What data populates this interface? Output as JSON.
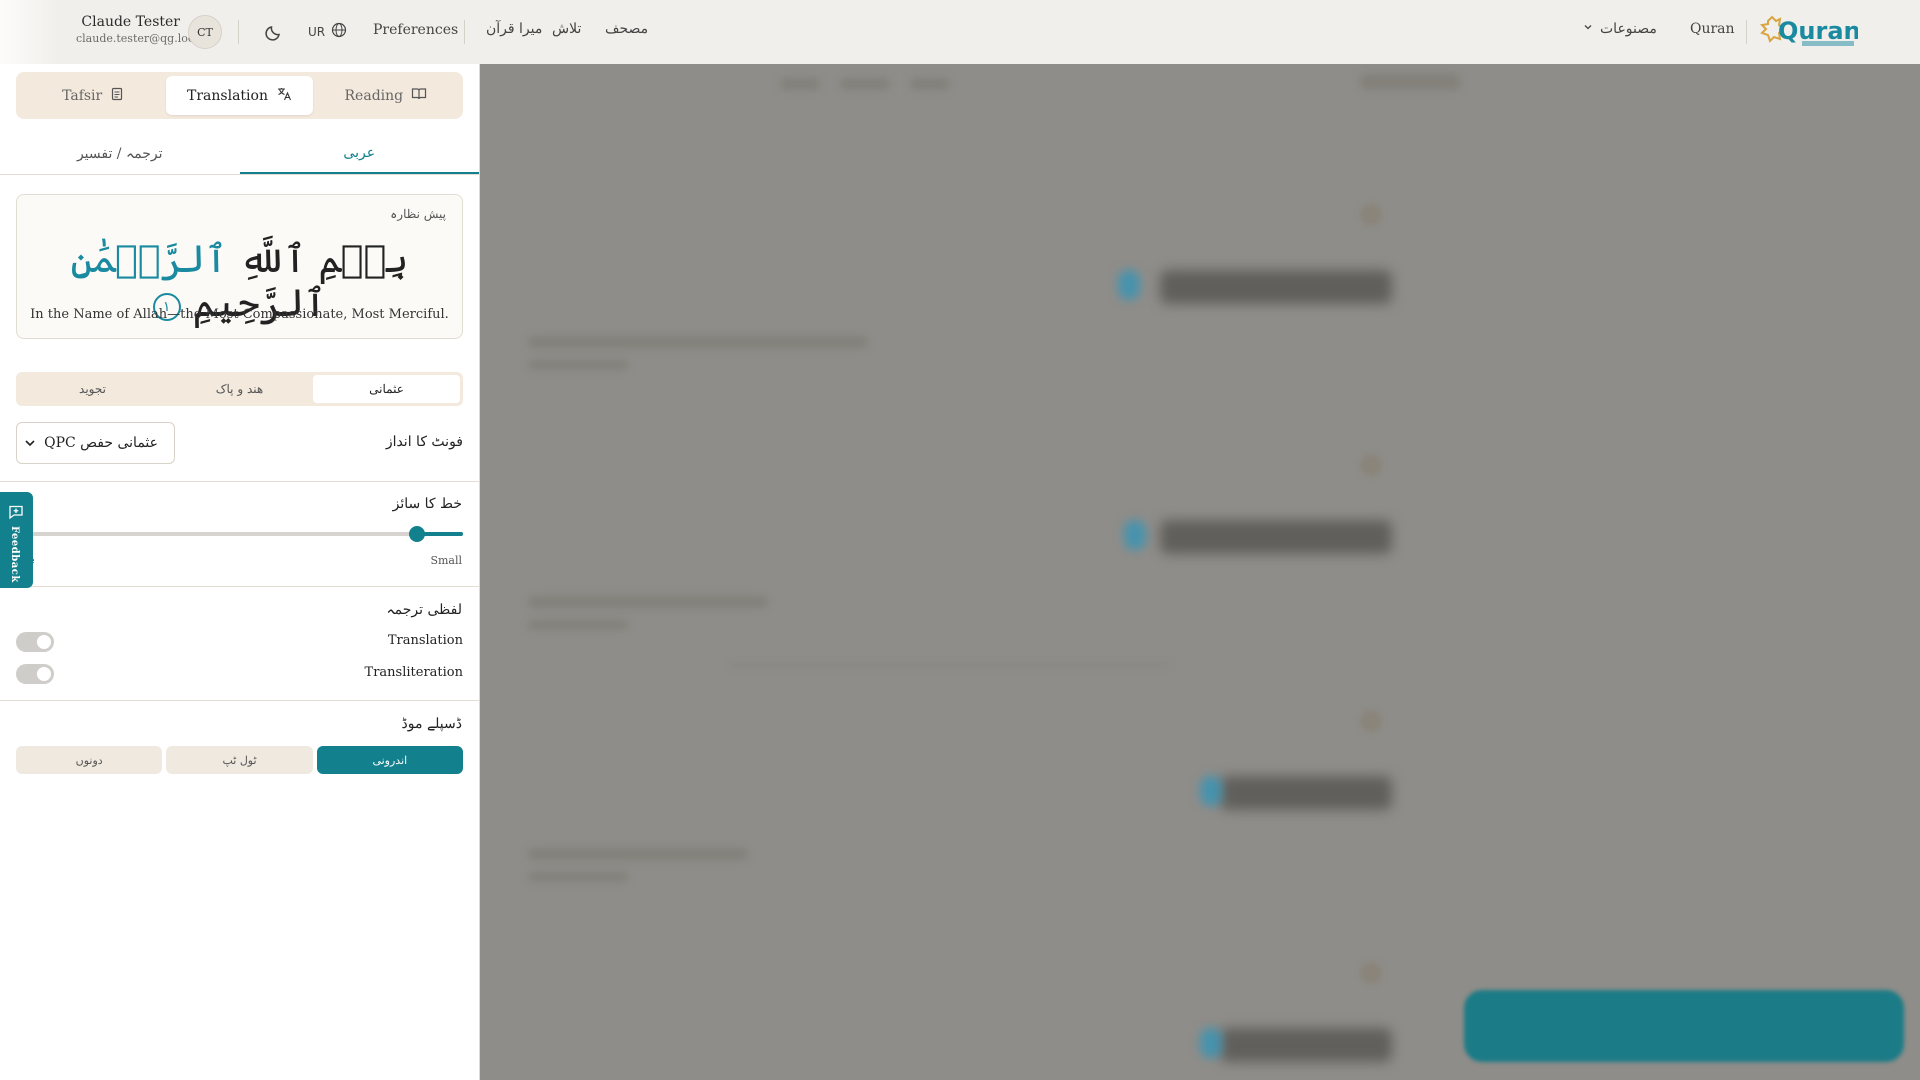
{
  "header": {
    "user_name": "Claude Tester",
    "user_email": "claude.tester@qg.local",
    "avatar_initials": "CT",
    "language": "UR",
    "preferences": "Preferences",
    "nav": [
      "مصحف",
      "تلاش",
      "میرا قرآن"
    ],
    "quran_link": "Quran",
    "products": "مصنوعات",
    "logo_text": "Quran"
  },
  "panel": {
    "mode_tabs": [
      {
        "label": "Tafsir",
        "icon": "document-icon"
      },
      {
        "label": "Translation",
        "icon": "translate-icon",
        "active": true
      },
      {
        "label": "Reading",
        "icon": "book-icon"
      }
    ],
    "sub_tabs": [
      {
        "label": "ترجمہ / تفسیر"
      },
      {
        "label": "عربی",
        "active": true
      }
    ],
    "preview": {
      "label": "پیش نظارہ",
      "arabic_start": "بِسۡمِ ٱللَّهِ",
      "arabic_teal": "ٱلرَّحۡمَٰنِ",
      "arabic_end": "ٱلرَّحِيمِ",
      "ayah_number": "١",
      "translation": "In the Name of Allah—the Most Compassionate, Most Merciful."
    },
    "script_tabs": [
      {
        "label": "عثمانی",
        "active": true
      },
      {
        "label": "ھند و پاک"
      },
      {
        "label": "تجوید"
      }
    ],
    "font_style": {
      "label": "فونٹ کا انداز",
      "value": "QPC عثمانی حفص"
    },
    "font_size": {
      "label": "خط کا سائز",
      "small": "Small",
      "large": "Large",
      "level": 0.1
    },
    "word_by_word": {
      "label": "لفظی ترجمہ",
      "translation": "Translation",
      "transliteration": "Transliteration"
    },
    "display_mode": {
      "label": "ڈسپلے موڈ",
      "buttons": [
        {
          "label": "اندرونی",
          "active": true
        },
        {
          "label": "ٹول ٹپ"
        },
        {
          "label": "دونوں"
        }
      ]
    },
    "feedback": "Feedback"
  },
  "colors": {
    "accent": "#12808d",
    "panel_bg": "#ffffff",
    "tab_bg": "#f3e9dd"
  }
}
